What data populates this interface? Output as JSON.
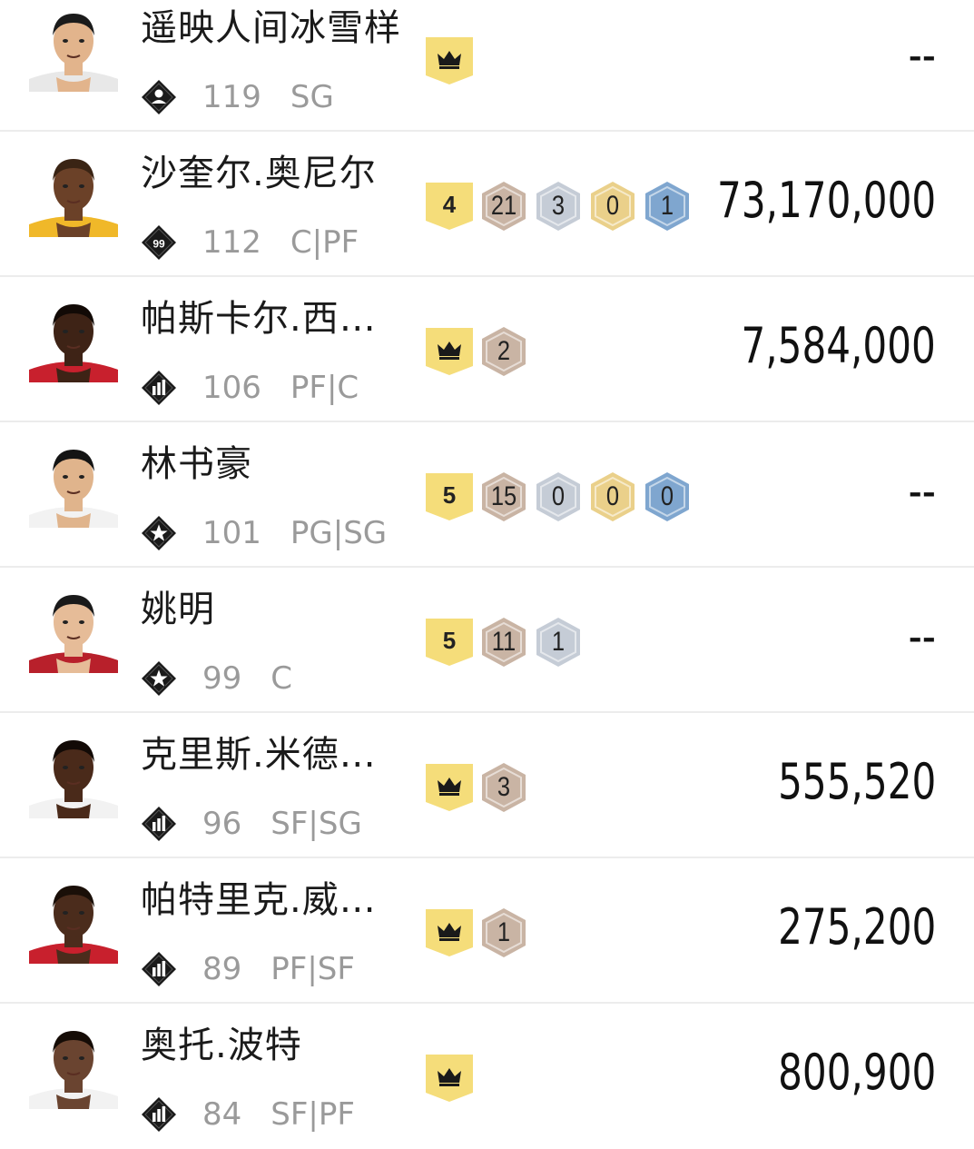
{
  "players": [
    {
      "name": "遥映人间冰雪样",
      "ovr": "119",
      "pos": "SG",
      "tier_icon": "person-diamond-icon",
      "value": "--",
      "badges": [
        {
          "kind": "crown",
          "label": ""
        }
      ],
      "skin": "#e2b48c",
      "hair": "#1b1b1b",
      "jersey": "#e8e8e8"
    },
    {
      "name": "沙奎尔.奥尼尔",
      "ovr": "112",
      "pos": "C|PF",
      "tier_icon": "99-diamond-icon",
      "value": "73,170,000",
      "badges": [
        {
          "kind": "flag",
          "label": "4"
        },
        {
          "kind": "bronze",
          "label": "21"
        },
        {
          "kind": "silver",
          "label": "3"
        },
        {
          "kind": "gold",
          "label": "0"
        },
        {
          "kind": "blue",
          "label": "1"
        }
      ],
      "skin": "#6b4128",
      "hair": "#3a2414",
      "jersey": "#f0b829"
    },
    {
      "name": "帕斯卡尔.西…",
      "ovr": "106",
      "pos": "PF|C",
      "tier_icon": "bars-diamond-icon",
      "value": "7,584,000",
      "badges": [
        {
          "kind": "crown",
          "label": ""
        },
        {
          "kind": "bronze",
          "label": "2"
        }
      ],
      "skin": "#3e2316",
      "hair": "#120a06",
      "jersey": "#c8202d"
    },
    {
      "name": "林书豪",
      "ovr": "101",
      "pos": "PG|SG",
      "tier_icon": "star-diamond-icon",
      "value": "--",
      "badges": [
        {
          "kind": "flag",
          "label": "5"
        },
        {
          "kind": "bronze",
          "label": "15"
        },
        {
          "kind": "silver",
          "label": "0"
        },
        {
          "kind": "gold",
          "label": "0"
        },
        {
          "kind": "blue",
          "label": "0"
        }
      ],
      "skin": "#e0b48c",
      "hair": "#141414",
      "jersey": "#f2f2f2"
    },
    {
      "name": "姚明",
      "ovr": "99",
      "pos": "C",
      "tier_icon": "star-diamond-icon",
      "value": "--",
      "badges": [
        {
          "kind": "flag",
          "label": "5"
        },
        {
          "kind": "bronze",
          "label": "11"
        },
        {
          "kind": "silver",
          "label": "1"
        }
      ],
      "skin": "#e6bc98",
      "hair": "#1a1a1a",
      "jersey": "#b8202b"
    },
    {
      "name": "克里斯.米德…",
      "ovr": "96",
      "pos": "SF|SG",
      "tier_icon": "bars-diamond-icon",
      "value": "555,520",
      "badges": [
        {
          "kind": "crown",
          "label": ""
        },
        {
          "kind": "bronze",
          "label": "3"
        }
      ],
      "skin": "#4a2a1a",
      "hair": "#120a06",
      "jersey": "#f2f2f2"
    },
    {
      "name": "帕特里克.威…",
      "ovr": "89",
      "pos": "PF|SF",
      "tier_icon": "bars-diamond-icon",
      "value": "275,200",
      "badges": [
        {
          "kind": "crown",
          "label": ""
        },
        {
          "kind": "bronze",
          "label": "1"
        }
      ],
      "skin": "#4b2c1c",
      "hair": "#1a0f08",
      "jersey": "#c8202d"
    },
    {
      "name": "奥托.波特",
      "ovr": "84",
      "pos": "SF|PF",
      "tier_icon": "bars-diamond-icon",
      "value": "800,900",
      "badges": [
        {
          "kind": "crown",
          "label": ""
        }
      ],
      "skin": "#6a4430",
      "hair": "#150c06",
      "jersey": "#f2f2f2"
    }
  ],
  "colors": {
    "crown_bg": "#f5dd7a",
    "bronze": "#c9b4a4",
    "silver": "#c5ccd6",
    "gold": "#ead08a",
    "blue": "#7fa6cf"
  }
}
